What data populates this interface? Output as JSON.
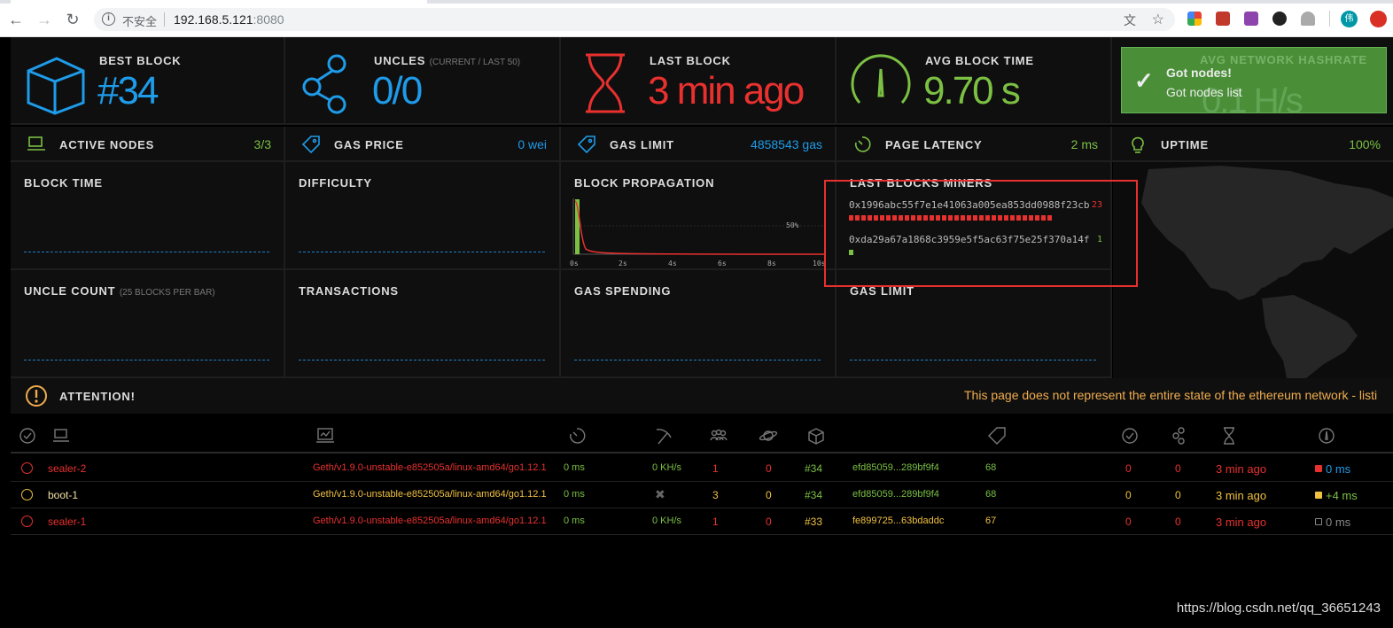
{
  "browser": {
    "insecure_label": "不安全",
    "host": "192.168.5.121",
    "port": ":8080",
    "profile_initial": "伟"
  },
  "stats": {
    "best_block": {
      "label": "BEST BLOCK",
      "value": "#34"
    },
    "uncles": {
      "label": "UNCLES",
      "sub": "(CURRENT / LAST 50)",
      "value": "0/0"
    },
    "last_block": {
      "label": "LAST BLOCK",
      "value": "3 min ago"
    },
    "avg_block_time": {
      "label": "AVG BLOCK TIME",
      "value": "9.70 s"
    },
    "avg_hashrate": {
      "label": "AVG NETWORK HASHRATE",
      "value": "0.1 H/s"
    }
  },
  "row2": {
    "active_nodes": {
      "label": "ACTIVE NODES",
      "value": "3/3"
    },
    "gas_price": {
      "label": "GAS PRICE",
      "value": "0 wei"
    },
    "gas_limit": {
      "label": "GAS LIMIT",
      "value": "4858543 gas"
    },
    "page_latency": {
      "label": "PAGE LATENCY",
      "value": "2 ms"
    },
    "uptime": {
      "label": "UPTIME",
      "value": "100%"
    }
  },
  "charts": {
    "block_time": "BLOCK TIME",
    "difficulty": "DIFFICULTY",
    "block_propagation": "BLOCK PROPAGATION",
    "last_blocks_miners": "LAST BLOCKS MINERS",
    "uncle_count": "UNCLE COUNT",
    "uncle_count_sub": "(25 BLOCKS PER BAR)",
    "transactions": "TRANSACTIONS",
    "gas_spending": "GAS SPENDING",
    "gas_limit": "GAS LIMIT"
  },
  "propagation": {
    "pct_label": "50%",
    "ticks": [
      "0s",
      "2s",
      "4s",
      "6s",
      "8s",
      "10s"
    ]
  },
  "miners": [
    {
      "address": "0x1996abc55f7e1e41063a005ea853dd0988f23cb",
      "count": "23",
      "color": "#e8312f"
    },
    {
      "address": "0xda29a67a1868c3959e5f5ac63f75e25f370a14f",
      "count": "1",
      "color": "#7bc043"
    }
  ],
  "toast": {
    "title": "Got nodes!",
    "message": "Got nodes list"
  },
  "attention": {
    "label": "ATTENTION!",
    "message": "This page does not represent the entire state of the ethereum network - listi"
  },
  "nodes": [
    {
      "name": "sealer-2",
      "client": "Geth/v1.9.0-unstable-e852505a/linux-amd64/go1.12.1",
      "latency": "0 ms",
      "hashrate": "0 KH/s",
      "peers": "1",
      "pending": "0",
      "block": "#34",
      "hash": "efd85059...289bf9f4",
      "difficulty": "68",
      "uncles_a": "0",
      "uncles_b": "0",
      "last_block": "3 min ago",
      "propagation": "0 ms",
      "status_color": "#e8312f",
      "name_color": "#e8312f",
      "client_color": "#e8312f",
      "block_color": "#7bc043",
      "prop_color": "#1e9be9",
      "prop_dot": "#e8312f"
    },
    {
      "name": "boot-1",
      "client": "Geth/v1.9.0-unstable-e852505a/linux-amd64/go1.12.1",
      "latency": "0 ms",
      "hashrate": "",
      "peers": "3",
      "pending": "0",
      "block": "#34",
      "hash": "efd85059...289bf9f4",
      "difficulty": "68",
      "uncles_a": "0",
      "uncles_b": "0",
      "last_block": "3 min ago",
      "propagation": "+4 ms",
      "status_color": "#f0c040",
      "name_color": "#f0e0a0",
      "client_color": "#f0c040",
      "block_color": "#7bc043",
      "prop_color": "#7bc043",
      "prop_dot": "#f0c040"
    },
    {
      "name": "sealer-1",
      "client": "Geth/v1.9.0-unstable-e852505a/linux-amd64/go1.12.1",
      "latency": "0 ms",
      "hashrate": "0 KH/s",
      "peers": "1",
      "pending": "0",
      "block": "#33",
      "hash": "fe899725...63bdaddc",
      "difficulty": "67",
      "uncles_a": "0",
      "uncles_b": "0",
      "last_block": "3 min ago",
      "propagation": "0 ms",
      "status_color": "#e8312f",
      "name_color": "#e8312f",
      "client_color": "#e8312f",
      "block_color": "#f0c040",
      "prop_color": "#888",
      "prop_dot": "#888"
    }
  ],
  "watermark": "https://blog.csdn.net/qq_36651243",
  "colors": {
    "blue": "#1e9be9",
    "red": "#e8312f",
    "green": "#7bc043",
    "orange": "#f0ad4e"
  }
}
